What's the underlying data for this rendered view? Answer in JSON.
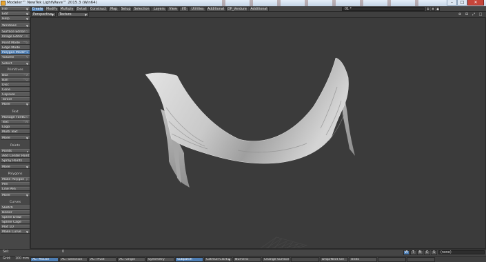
{
  "window": {
    "title": "Modeler™ NewTek LightWave™ 2015.3 (Win64)",
    "minimize_glyph": "–",
    "maximize_glyph": "□",
    "close_glyph": "✕"
  },
  "menu_tabs": [
    "Create",
    "Modify",
    "Multiply",
    "Detail",
    "Construct",
    "Map",
    "Setup",
    "Selection",
    "Layers",
    "View",
    "I/O",
    "Utilities",
    "Additional",
    "DP_Verdure",
    "Additional"
  ],
  "active_tab": "Create",
  "layer_dropdown": "01 *",
  "layer_icons": [
    "↓",
    "×",
    "▲"
  ],
  "left_panel": {
    "file": "File",
    "edit": "Edit",
    "help": "Help",
    "windows": "Windows",
    "surface_editor": "Surface Editor",
    "surface_editor_key": "F5",
    "image_editor": "Image Editor",
    "image_editor_key": "F6",
    "point_mode": "Point Mode",
    "point_mode_key": "^G",
    "edge_mode": "Edge Mode",
    "polygon_mode": "Polygon Mode",
    "polygon_mode_key": "^L",
    "volume": "Volume",
    "volume_key": "V",
    "select": "Select",
    "primitives_header": "Primitives",
    "box": "Box",
    "box_key": "^X",
    "ball": "Ball",
    "ball_key": "^O",
    "disc": "Disc",
    "cone": "Cone",
    "capsule": "Capsule",
    "toroid": "Toroid",
    "more1": "More",
    "text_header": "Text",
    "manage_fonts": "Manage Fonts",
    "manage_fonts_key": "F10",
    "text": "Text",
    "text_key": "^W",
    "logo": "Logo",
    "multi_text": "Multi Text",
    "more2": "More",
    "points_header": "Points",
    "points": "Points",
    "add_center_point": "Add Center Point",
    "spray_points": "Spray Points",
    "more3": "More",
    "polygons_header": "Polygons",
    "make_polygon": "Make Polygon",
    "make_polygon_key": "p",
    "pen": "Pen",
    "line_pen": "Line Pen",
    "more4": "More",
    "curves_header": "Curves",
    "sketch": "Sketch",
    "bezier": "Bezier",
    "spline_draw": "Spline Draw",
    "spline_cage": "Spline Cage",
    "plot_1d": "Plot 1D",
    "make_curve": "Make Curve"
  },
  "viewport": {
    "view_dropdown": "Perspective",
    "render_dropdown": "Texture",
    "icons": [
      "⊕",
      "⊞",
      "⤢",
      "□"
    ]
  },
  "bottom1": {
    "sel_label": "Sel:",
    "sel_value": "0",
    "modes": [
      "W",
      "T",
      "M",
      "C",
      "S"
    ],
    "active_mode": "W",
    "surface_field": "(none)"
  },
  "bottom2": {
    "grid_label": "Grid:",
    "grid_value": "100 mm",
    "buttons": [
      "AC: Mouse",
      "AC: Selection",
      "AC: Pivot",
      "AC: Origin",
      "Symmetry",
      "Subpatch",
      "Catmull-Clark",
      "Numeric",
      "Change Surface",
      "",
      "Drop/Next Sel",
      "Undo",
      "",
      ""
    ]
  },
  "colors": {
    "accent": "#4d7db3",
    "viewport_bg": "#3b3b3b",
    "panel_bg": "#474747"
  }
}
